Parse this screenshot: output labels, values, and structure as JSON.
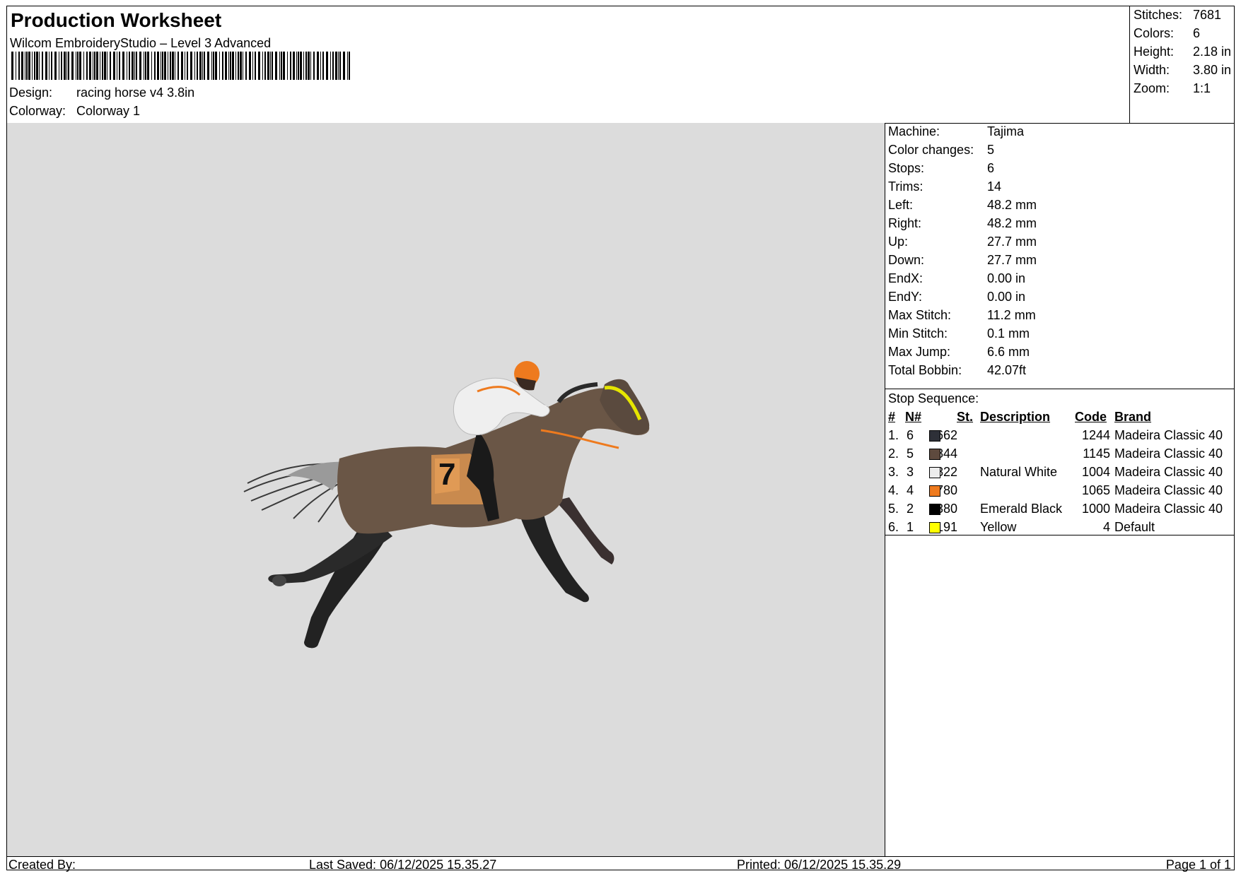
{
  "header": {
    "title": "Production Worksheet",
    "software": "Wilcom EmbroideryStudio – Level 3 Advanced",
    "design_label": "Design:",
    "design_value": "racing horse v4 3.8in",
    "colorway_label": "Colorway:",
    "colorway_value": "Colorway 1"
  },
  "summary": [
    {
      "label": "Stitches:",
      "value": "7681"
    },
    {
      "label": "Colors:",
      "value": "6"
    },
    {
      "label": "Height:",
      "value": "2.18 in"
    },
    {
      "label": "Width:",
      "value": "3.80 in"
    },
    {
      "label": "Zoom:",
      "value": "1:1"
    }
  ],
  "properties": [
    {
      "label": "Machine:",
      "value": "Tajima"
    },
    {
      "label": "Color changes:",
      "value": "5"
    },
    {
      "label": "Stops:",
      "value": "6"
    },
    {
      "label": "Trims:",
      "value": "14"
    },
    {
      "label": "Left:",
      "value": "48.2 mm"
    },
    {
      "label": "Right:",
      "value": "48.2 mm"
    },
    {
      "label": "Up:",
      "value": "27.7 mm"
    },
    {
      "label": "Down:",
      "value": "27.7 mm"
    },
    {
      "label": "EndX:",
      "value": "0.00 in"
    },
    {
      "label": "EndY:",
      "value": "0.00 in"
    },
    {
      "label": "Max Stitch:",
      "value": "11.2 mm"
    },
    {
      "label": "Min Stitch:",
      "value": "0.1 mm"
    },
    {
      "label": "Max Jump:",
      "value": "6.6 mm"
    },
    {
      "label": "Total Bobbin:",
      "value": "42.07ft"
    }
  ],
  "stop_sequence": {
    "title": "Stop Sequence:",
    "headers": {
      "num": "#",
      "n": "N#",
      "st": "St.",
      "description": "Description",
      "code": "Code",
      "brand": "Brand"
    },
    "rows": [
      {
        "num": "1.",
        "n": "6",
        "st": "662",
        "description": "",
        "code": "1244",
        "brand": "Madeira Classic 40",
        "color": "#2e3038"
      },
      {
        "num": "2.",
        "n": "5",
        "st": "2844",
        "description": "",
        "code": "1145",
        "brand": "Madeira Classic 40",
        "color": "#5e4a3e"
      },
      {
        "num": "3.",
        "n": "3",
        "st": "822",
        "description": "Natural White",
        "code": "1004",
        "brand": "Madeira Classic 40",
        "color": "#ececec"
      },
      {
        "num": "4.",
        "n": "4",
        "st": "780",
        "description": "",
        "code": "1065",
        "brand": "Madeira Classic 40",
        "color": "#ee7a1e"
      },
      {
        "num": "5.",
        "n": "2",
        "st": "2380",
        "description": "Emerald Black",
        "code": "1000",
        "brand": "Madeira Classic 40",
        "color": "#000000"
      },
      {
        "num": "6.",
        "n": "1",
        "st": "191",
        "description": "Yellow",
        "code": "4",
        "brand": "Default",
        "color": "#ffff00"
      }
    ]
  },
  "footer": {
    "created_by": "Created By:",
    "last_saved": "Last Saved: 06/12/2025 15.35.27",
    "printed": "Printed: 06/12/2025 15.35.29",
    "page": "Page 1 of 1"
  },
  "preview": {
    "background": "#dcdcdc",
    "saddle_number": "7"
  }
}
